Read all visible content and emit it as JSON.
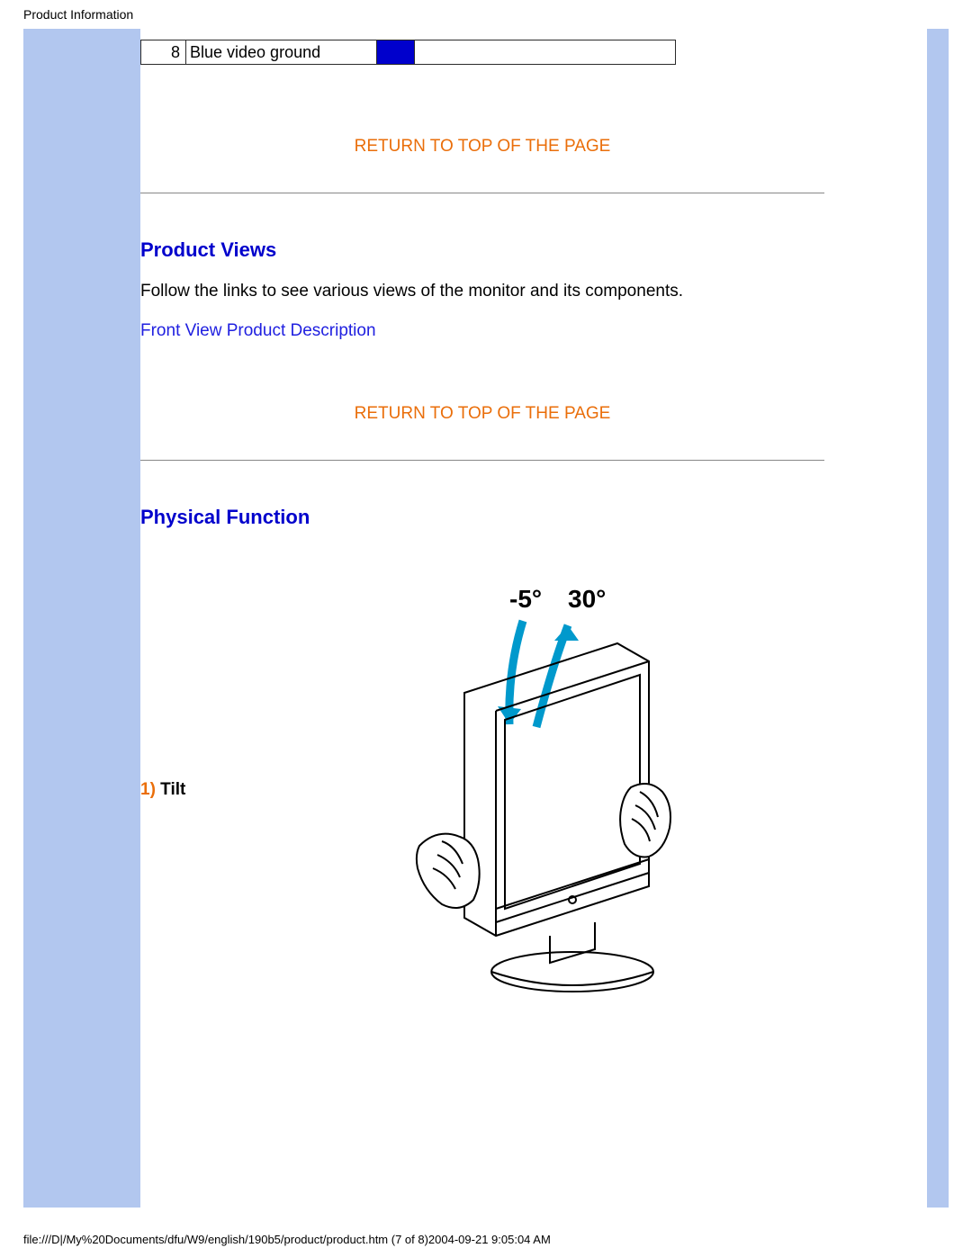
{
  "header": {
    "title": "Product Information"
  },
  "pinTable": {
    "num": "8",
    "desc": "Blue video ground"
  },
  "links": {
    "returnTop": "RETURN TO TOP OF THE PAGE",
    "frontView": "Front View Product Description"
  },
  "sections": {
    "productViews": {
      "heading": "Product Views",
      "body": "Follow the links to see various views of the monitor and its components."
    },
    "physicalFunction": {
      "heading": "Physical Function",
      "tilt": {
        "num": "1)",
        "label": " Tilt",
        "angle1": "-5°",
        "angle2": "30°"
      }
    }
  },
  "footer": {
    "path": "file:///D|/My%20Documents/dfu/W9/english/190b5/product/product.htm (7 of 8)2004-09-21 9:05:04 AM"
  }
}
